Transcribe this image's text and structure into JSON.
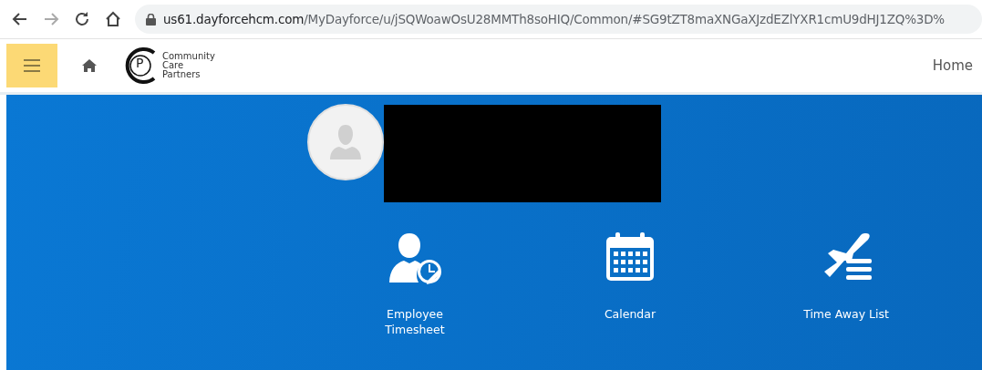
{
  "browser": {
    "url_domain": "us61.dayforcehcm.com",
    "url_path": "/MyDayforce/u/jSQWoawOsU28MMTh8soHIQ/Common/#SG9tZT8maXNGaXJzdEZlYXR1cmU9dHJ1ZQ%3D%"
  },
  "header": {
    "logo_mark": "P",
    "logo_lines": [
      "Community",
      "Care",
      "Partners"
    ],
    "home_link": "Home"
  },
  "tiles": [
    {
      "kind": "timesheet",
      "label": "Employee Timesheet"
    },
    {
      "kind": "calendar",
      "label": "Calendar"
    },
    {
      "kind": "timeaway",
      "label": "Time Away List"
    }
  ]
}
